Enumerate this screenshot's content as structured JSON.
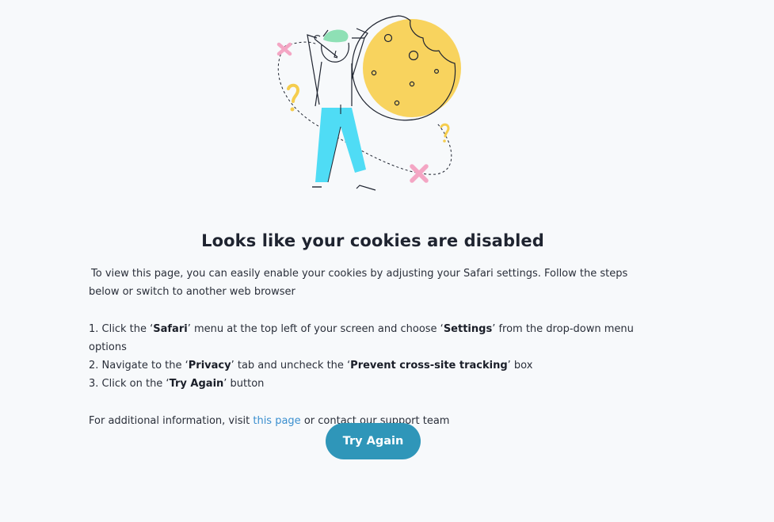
{
  "heading": "Looks like your cookies are disabled",
  "intro": "To view this page, you can easily enable your cookies by adjusting your Safari settings. Follow the steps below or switch to another web browser",
  "steps": [
    {
      "num": "1. Click the ‘",
      "b1": "Safari",
      "mid": "’ menu at the top left of your screen and choose ‘",
      "b2": "Settings",
      "end": "’ from the drop-down menu options"
    },
    {
      "num": "2. Navigate to the ‘",
      "b1": "Privacy",
      "mid": "’ tab and uncheck the ‘",
      "b2": "Prevent cross-site tracking",
      "end": "’ box"
    },
    {
      "num": "3. Click on the ‘",
      "b1": "Try Again",
      "end": "’ button"
    }
  ],
  "info": {
    "before": "For additional information, visit ",
    "link": "this page",
    "after": " or contact our support team"
  },
  "button": "Try Again",
  "colors": {
    "accent": "#2f96b9",
    "link": "#3b8fcf",
    "cookie": "#f8d35e",
    "pants": "#4fdcf5",
    "hair": "#8ee0b5",
    "cross": "#f4a6c4",
    "question": "#f5cd4e"
  },
  "icons": [
    "cookie-icon",
    "person-illustration",
    "question-mark-icon",
    "cross-icon"
  ]
}
